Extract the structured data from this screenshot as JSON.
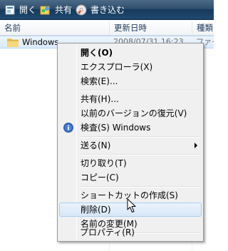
{
  "toolbar": {
    "items": [
      {
        "label": "開く",
        "icon": "open-icon"
      },
      {
        "label": "共有",
        "icon": "share-icon"
      },
      {
        "label": "書き込む",
        "icon": "burn-icon"
      }
    ]
  },
  "columns": [
    "名前",
    "更新日時",
    "種類"
  ],
  "file": {
    "name": "Windows",
    "modified": "2008/07/31 16:23",
    "type": "ファイ",
    "icon": "folder-icon"
  },
  "context_menu": {
    "items": [
      {
        "label": "開く(O)",
        "bold": true
      },
      {
        "label": "エクスプローラ(X)"
      },
      {
        "label": "検索(E)..."
      },
      {
        "label": "共有(H)..."
      },
      {
        "label": "以前のバージョンの復元(V)"
      },
      {
        "label": "検査(S) Windows",
        "icon": "scan-icon"
      },
      {
        "label": "送る(N)",
        "submenu": true
      },
      {
        "label": "切り取り(T)"
      },
      {
        "label": "コピー(C)"
      },
      {
        "label": "ショートカットの作成(S)"
      },
      {
        "label": "削除(D)",
        "highlighted": true
      },
      {
        "label": "名前の変更(M)"
      },
      {
        "label": "プロパティ(R)"
      }
    ]
  },
  "colors": {
    "toolbar_bg": "#1f4a6f",
    "selection": "#dbeafb",
    "menu_bg": "#f0f0f0",
    "highlight_border": "#a8cdf3"
  }
}
